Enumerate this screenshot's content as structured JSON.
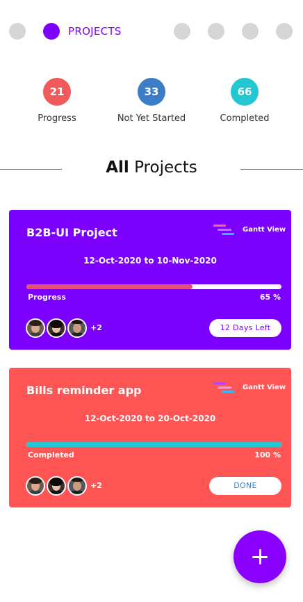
{
  "nav": {
    "active_label": "PROJECTS",
    "colors": {
      "active": "#7b00ff",
      "inactive": "#d6d6d6"
    }
  },
  "stats": [
    {
      "value": "21",
      "label": "Progress",
      "color": "#f05a5a"
    },
    {
      "value": "33",
      "label": "Not Yet Started",
      "color": "#3d7dc8"
    },
    {
      "value": "66",
      "label": "Completed",
      "color": "#22c7d1"
    }
  ],
  "section": {
    "title_bold": "All",
    "title_rest": " Projects"
  },
  "projects": [
    {
      "title": "B2B-UI Project",
      "gantt_label": "Gantt View",
      "dates": "12-Oct-2020 to 10-Nov-2020",
      "progress_label": "Progress",
      "percent_text": "65 %",
      "percent": 65,
      "extra_members": "+2",
      "status": "12 Days Left",
      "card_color": "#7b00ff",
      "bar_color": "#e9506a",
      "status_text_color": "#7b00ff"
    },
    {
      "title": "Bills reminder app",
      "gantt_label": "Gantt View",
      "dates": "12-Oct-2020 to 20-Oct-2020",
      "progress_label": "Completed",
      "percent_text": "100 %",
      "percent": 100,
      "extra_members": "+2",
      "status": "DONE",
      "card_color": "#ff5555",
      "bar_color": "#22c7d1",
      "status_text_color": "#3d7dc8"
    }
  ],
  "icons": {
    "fab": "plus-icon",
    "gantt": "gantt-chart-icon",
    "avatar": "user-avatar"
  }
}
